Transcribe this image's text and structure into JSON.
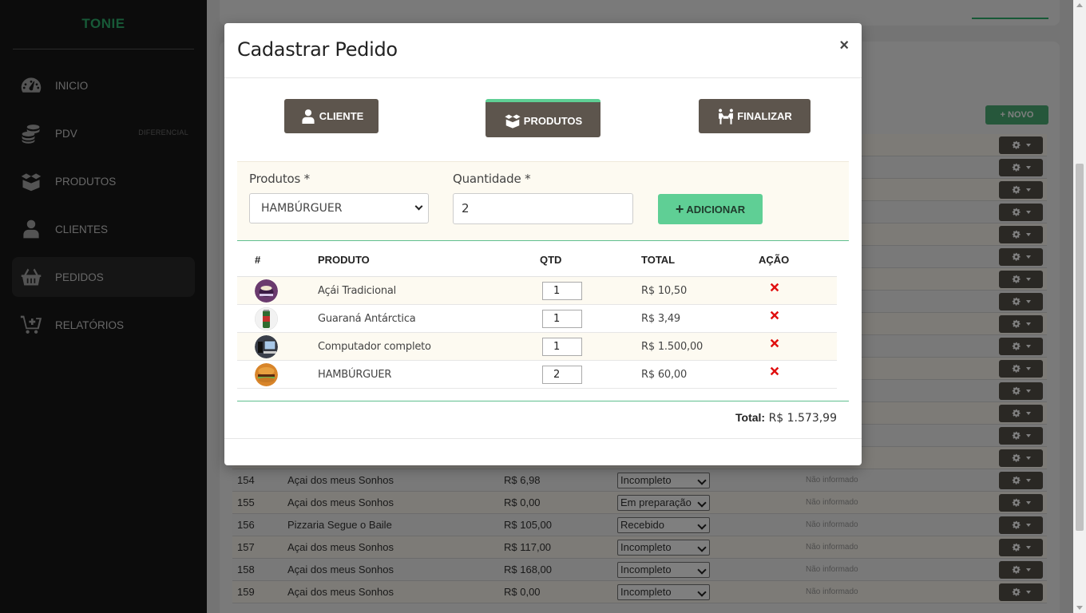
{
  "sidebar": {
    "brand": "TONIE",
    "items": [
      {
        "label": "INICIO",
        "icon": "dashboard-gauge-icon"
      },
      {
        "label": "PDV",
        "badge": "DIFERENCIAL",
        "icon": "coins-stack-icon"
      },
      {
        "label": "PRODUTOS",
        "icon": "open-box-icon"
      },
      {
        "label": "CLIENTES",
        "icon": "user-icon"
      },
      {
        "label": "PEDIDOS",
        "icon": "shopping-basket-icon",
        "active": true
      },
      {
        "label": "RELATÓRIOS",
        "icon": "cart-plus-icon"
      }
    ]
  },
  "background": {
    "novo_label": "NOVO",
    "rows": [
      {
        "id": "154",
        "name": "Açai dos meus Sonhos",
        "price": "R$ 6,98",
        "status": "Incompleto",
        "extra": "Não informado"
      },
      {
        "id": "155",
        "name": "Açai dos meus Sonhos",
        "price": "R$ 0,00",
        "status": "Em preparação",
        "extra": "Não informado"
      },
      {
        "id": "156",
        "name": "Pizzaria Segue o Baile",
        "price": "R$ 105,00",
        "status": "Recebido",
        "extra": "Não informado"
      },
      {
        "id": "157",
        "name": "Açai dos meus Sonhos",
        "price": "R$ 117,00",
        "status": "Incompleto",
        "extra": "Não informado"
      },
      {
        "id": "158",
        "name": "Açai dos meus Sonhos",
        "price": "R$ 168,00",
        "status": "Incompleto",
        "extra": "Não informado"
      },
      {
        "id": "159",
        "name": "Açai dos meus Sonhos",
        "price": "R$ 0,00",
        "status": "Incompleto",
        "extra": "Não informado"
      }
    ]
  },
  "modal": {
    "title": "Cadastrar Pedido",
    "close": "×",
    "steps": [
      {
        "label": "CLIENTE",
        "icon": "user-icon"
      },
      {
        "label": "PRODUTOS",
        "icon": "open-box-icon",
        "active": true
      },
      {
        "label": "FINALIZAR",
        "icon": "people-carry-icon"
      }
    ],
    "form": {
      "product_label": "Produtos *",
      "product_value": "HAMBÚRGUER",
      "qty_label": "Quantidade *",
      "qty_value": "2",
      "add_label": "ADICIONAR"
    },
    "table": {
      "headers": [
        "#",
        "PRODUTO",
        "QTD",
        "TOTAL",
        "AÇÃO"
      ],
      "rows": [
        {
          "product": "Açái Tradicional",
          "qty": "1",
          "total": "R$ 10,50"
        },
        {
          "product": "Guaraná Antárctica",
          "qty": "1",
          "total": "R$ 3,49"
        },
        {
          "product": "Computador completo",
          "qty": "1",
          "total": "R$ 1.500,00"
        },
        {
          "product": "HAMBÚRGUER",
          "qty": "2",
          "total": "R$ 60,00"
        }
      ],
      "total_label": "Total:",
      "total_value": "R$ 1.573,99"
    }
  },
  "colors": {
    "brand_green": "#2fb36e",
    "accent_green": "#5fcf95",
    "dark_button": "#5d554d",
    "sidebar_bg": "#181818",
    "delete_red": "#e01010"
  }
}
